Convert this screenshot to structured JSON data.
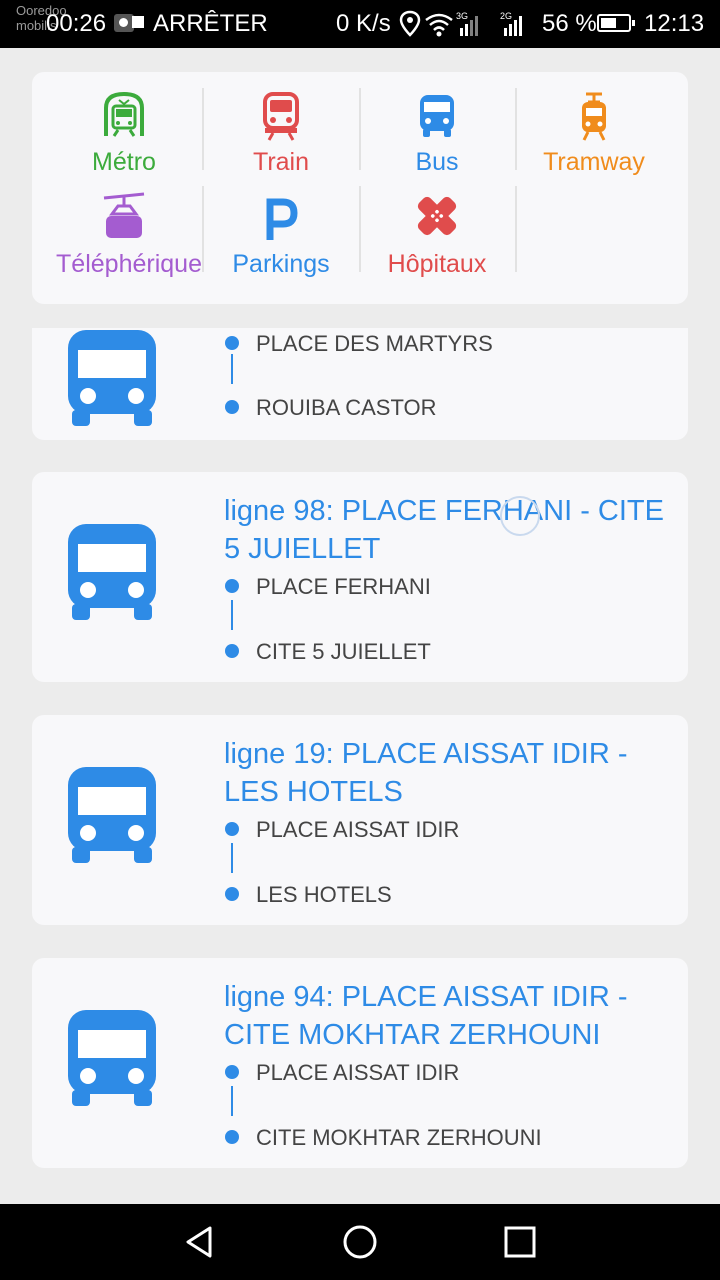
{
  "status_bar": {
    "carrier": "Ooredoo mobilis",
    "time_left": "00:26",
    "stop_label": "ARRÊTER",
    "speed": "0 K/s",
    "net1": "3G",
    "net2": "2G",
    "battery_pct": "56 %",
    "battery_level": 0.56,
    "time": "12:13"
  },
  "categories": [
    {
      "label": "Métro",
      "color": "#3cab3c",
      "icon": "metro-icon"
    },
    {
      "label": "Train",
      "color": "#e04c4c",
      "icon": "train-icon"
    },
    {
      "label": "Bus",
      "color": "#2e8be6",
      "icon": "bus-icon"
    },
    {
      "label": "Tramway",
      "color": "#f08c1c",
      "icon": "tramway-icon"
    },
    {
      "label": "Téléphérique",
      "color": "#a45cd0",
      "icon": "cable-car-icon"
    },
    {
      "label": "Parkings",
      "color": "#2e8be6",
      "icon": "parking-icon"
    },
    {
      "label": "Hôpitaux",
      "color": "#e04c4c",
      "icon": "hospital-icon"
    }
  ],
  "lines": [
    {
      "title": "",
      "stop_a": "PLACE DES MARTYRS",
      "stop_b": "ROUIBA CASTOR"
    },
    {
      "title": "ligne 98: PLACE FERHANI  - CITE 5 JUIELLET",
      "stop_a": "PLACE FERHANI",
      "stop_b": "CITE 5 JUIELLET"
    },
    {
      "title": "ligne 19: PLACE AISSAT IDIR  - LES HOTELS",
      "stop_a": "PLACE AISSAT IDIR",
      "stop_b": "LES HOTELS"
    },
    {
      "title": "ligne 94: PLACE AISSAT IDIR  - CITE MOKHTAR ZERHOUNI",
      "stop_a": "PLACE AISSAT IDIR",
      "stop_b": "CITE MOKHTAR ZERHOUNI"
    }
  ],
  "colors": {
    "accent": "#2e8be6",
    "background": "#ececec",
    "card": "#f8f8fa"
  }
}
